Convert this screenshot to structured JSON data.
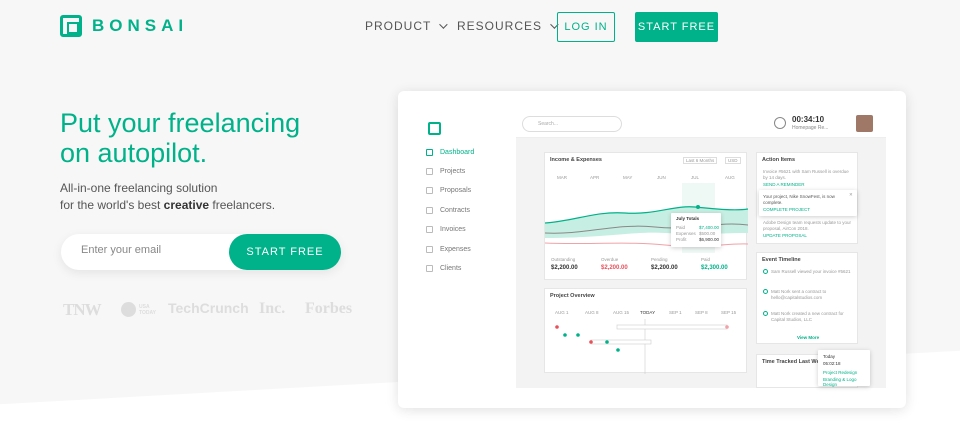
{
  "brand": {
    "name": "BONSAI"
  },
  "nav": {
    "product": "PRODUCT",
    "resources": "RESOURCES",
    "login": "LOG IN",
    "start_free": "START FREE"
  },
  "hero": {
    "headline_line1": "Put your freelancing",
    "headline_line2": "on autopilot.",
    "sub_line1": "All-in-one freelancing solution",
    "sub_line2_pre": "for the world's best ",
    "sub_line2_bold": "creative",
    "sub_line2_post": " freelancers.",
    "email_placeholder": "Enter your email",
    "cta": "START FREE"
  },
  "press": [
    "TNW",
    "USA TODAY",
    "TechCrunch",
    "Inc.",
    "Forbes"
  ],
  "app": {
    "sidebar": [
      "Dashboard",
      "Projects",
      "Proposals",
      "Contracts",
      "Invoices",
      "Expenses",
      "Clients"
    ],
    "search_placeholder": "Search...",
    "timer": "00:34:10",
    "timer_project": "Homepage Re...",
    "income": {
      "title": "Income & Expenses",
      "range": "Last 6 Months",
      "currency": "USD",
      "months": [
        "MAR",
        "APR",
        "MAY",
        "JUN",
        "JUL",
        "AUG"
      ],
      "tooltip_title": "July Totals",
      "tooltip_rows": [
        {
          "k": "Paid",
          "v": "$7,400.00"
        },
        {
          "k": "Expenses",
          "v": "$500.00"
        },
        {
          "k": "Profit",
          "v": "$6,900.00"
        }
      ],
      "stats": [
        {
          "label": "Outstanding",
          "value": "$2,200.00",
          "color": "#333333"
        },
        {
          "label": "Overdue",
          "value": "$2,200.00",
          "color": "#e8505b"
        },
        {
          "label": "Pending",
          "value": "$2,200.00",
          "color": "#333333"
        },
        {
          "label": "Paid",
          "value": "$2,300.00",
          "color": "#00b289"
        }
      ]
    },
    "project_overview": {
      "title": "Project Overview",
      "cols": [
        "AUG 1",
        "AUG 8",
        "AUG 15",
        "TODAY",
        "SEP 1",
        "SEP 8",
        "SEP 15"
      ]
    },
    "action_items": {
      "title": "Action Items",
      "item1": "Invoice #5621 with Sam Russell is overdue by 14 days.",
      "item1_link": "SEND A REMINDER",
      "popup": "Your project, Nike SnowFest, is now complete.",
      "popup_link": "COMPLETE PROJECT",
      "item3": "Adobe Design team requests update to your proposal, AirCon 2018.",
      "item3_link": "UPDATE PROPOSAL"
    },
    "timeline": {
      "title": "Event Timeline",
      "events": [
        "Sam Russell viewed your invoice #5621",
        "Matt Nork sent a contract to hello@capitalstudios.com",
        "Matt Nork created a new contract for Capital Studios, LLC"
      ],
      "view_more": "View More"
    },
    "time_tracked": {
      "title": "Time Tracked Last Week",
      "today_label": "Today",
      "today_value": "05:02:18",
      "today_project": "Project Redesign",
      "today_task": "Branding & Logo Design"
    }
  }
}
